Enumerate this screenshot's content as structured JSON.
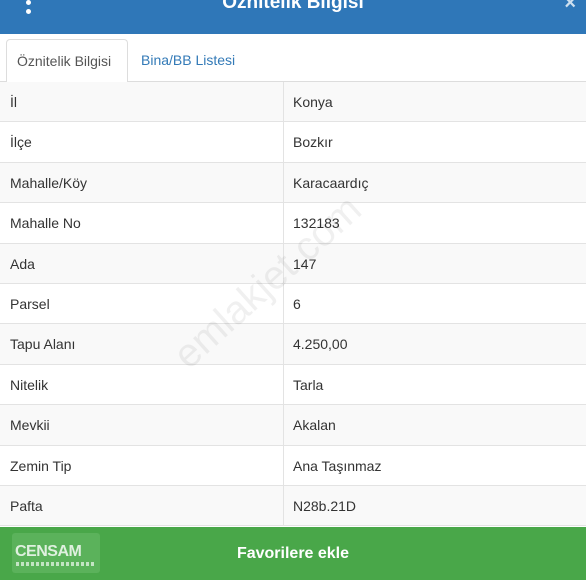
{
  "header": {
    "title": "Öznitelik Bilgisi",
    "close": "×"
  },
  "tabs": [
    {
      "label": "Öznitelik Bilgisi"
    },
    {
      "label": "Bina/BB Listesi"
    }
  ],
  "rows": [
    {
      "key": "İl",
      "value": "Konya"
    },
    {
      "key": "İlçe",
      "value": "Bozkır"
    },
    {
      "key": "Mahalle/Köy",
      "value": "Karacaardıç"
    },
    {
      "key": "Mahalle No",
      "value": "132183"
    },
    {
      "key": "Ada",
      "value": "147"
    },
    {
      "key": "Parsel",
      "value": "6"
    },
    {
      "key": "Tapu Alanı",
      "value": "4.250,00"
    },
    {
      "key": "Nitelik",
      "value": "Tarla"
    },
    {
      "key": "Mevkii",
      "value": "Akalan"
    },
    {
      "key": "Zemin Tip",
      "value": "Ana Taşınmaz"
    },
    {
      "key": "Pafta",
      "value": "N28b.21D"
    }
  ],
  "footer": {
    "button_label": "Favorilere ekle",
    "logo_text": "CENSAM"
  },
  "watermark": "emlakjet.com",
  "colors": {
    "header": "#2f77b8",
    "footer": "#49a749",
    "link": "#337ab7"
  }
}
